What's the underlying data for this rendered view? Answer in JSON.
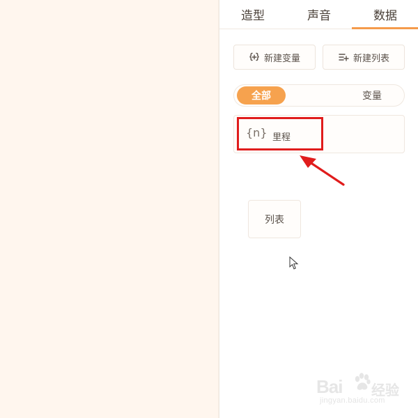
{
  "tabs": [
    {
      "label": "造型",
      "active": false
    },
    {
      "label": "声音",
      "active": false
    },
    {
      "label": "数据",
      "active": true
    }
  ],
  "toolbar": {
    "new_variable_label": "新建变量",
    "new_list_label": "新建列表",
    "new_variable_icon": "braces-plus-icon",
    "new_list_icon": "list-add-icon"
  },
  "filter": {
    "all_label": "全部",
    "variable_label": "变量",
    "list_label": "列表",
    "selected": "全部"
  },
  "variables": [
    {
      "glyph": "{n}",
      "name": "里程"
    }
  ],
  "colors": {
    "accent": "#f6a24e",
    "highlight_red": "#e01c1c",
    "panel_bg": "#ffffff",
    "canvas_bg": "#fff6ee"
  },
  "watermark": {
    "brand": "Bai",
    "text": "经验",
    "url": "jingyan.baidu.com"
  }
}
